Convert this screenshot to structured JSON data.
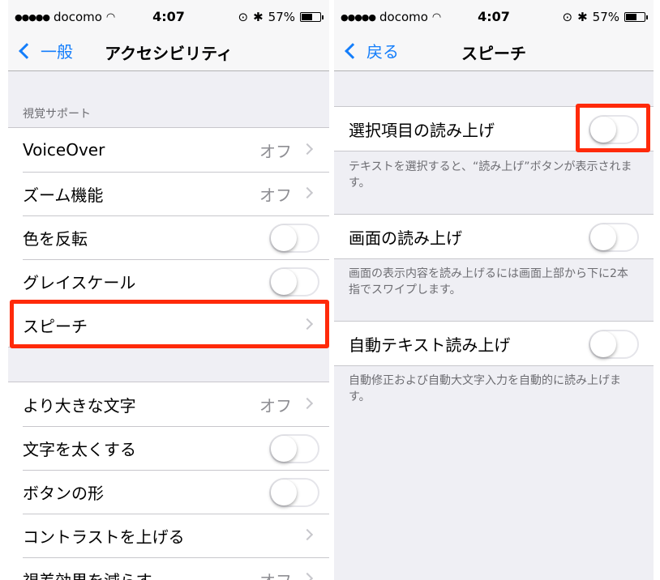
{
  "colors": {
    "accent": "#147efb",
    "highlight": "#ff2a0a",
    "background": "#efeff4"
  },
  "left": {
    "status": {
      "carrier": "docomo",
      "signal": "●●●●●",
      "time": "4:07",
      "battery": "57%",
      "battery_level": 0.57
    },
    "nav": {
      "back_label": "一般",
      "title": "アクセシビリティ"
    },
    "section_header": "視覚サポート",
    "group1": [
      {
        "label": "VoiceOver",
        "detail": "オフ",
        "accessory": "chevron-icon"
      },
      {
        "label": "ズーム機能",
        "detail": "オフ",
        "accessory": "chevron-icon"
      },
      {
        "label": "色を反転",
        "accessory": "toggle-off"
      },
      {
        "label": "グレイスケール",
        "accessory": "toggle-off"
      },
      {
        "label": "スピーチ",
        "accessory": "chevron-icon",
        "highlighted": true
      }
    ],
    "group2": [
      {
        "label": "より大きな文字",
        "detail": "オフ",
        "accessory": "chevron-icon"
      },
      {
        "label": "文字を太くする",
        "accessory": "toggle-off"
      },
      {
        "label": "ボタンの形",
        "accessory": "toggle-off"
      },
      {
        "label": "コントラストを上げる",
        "accessory": "chevron-icon"
      },
      {
        "label": "視差効果を減らす",
        "detail": "オフ",
        "accessory": "chevron-icon"
      }
    ]
  },
  "right": {
    "status": {
      "carrier": "docomo",
      "signal": "●●●●●",
      "time": "4:07",
      "battery": "57%",
      "battery_level": 0.57
    },
    "nav": {
      "back_label": "戻る",
      "title": "スピーチ"
    },
    "items": [
      {
        "label": "選択項目の読み上げ",
        "accessory": "toggle-off",
        "highlighted": true,
        "footer": "テキストを選択すると、“読み上げ”ボタンが表示されます。"
      },
      {
        "label": "画面の読み上げ",
        "accessory": "toggle-off",
        "footer": "画面の表示内容を読み上げるには画面上部から下に2本指でスワイプします。"
      },
      {
        "label": "自動テキスト読み上げ",
        "accessory": "toggle-off",
        "footer": "自動修正および自動大文字入力を自動的に読み上げます。"
      }
    ]
  }
}
